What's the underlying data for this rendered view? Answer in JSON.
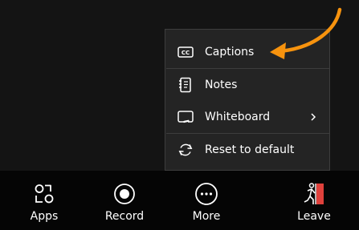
{
  "menu": {
    "items": [
      {
        "label": "Captions",
        "icon": "closed-captions-icon"
      },
      {
        "label": "Notes",
        "icon": "notes-icon"
      },
      {
        "label": "Whiteboard",
        "icon": "whiteboard-icon",
        "has_submenu": true
      },
      {
        "label": "Reset to default",
        "icon": "reset-icon"
      }
    ]
  },
  "toolbar": {
    "buttons": [
      {
        "label": "Apps",
        "icon": "apps-icon"
      },
      {
        "label": "Record",
        "icon": "record-icon"
      },
      {
        "label": "More",
        "icon": "more-icon"
      },
      {
        "label": "Leave",
        "icon": "leave-icon"
      }
    ]
  },
  "colors": {
    "background": "#141414",
    "menu_background": "#242424",
    "toolbar_background": "#050505",
    "annotation_arrow": "#f7930e",
    "leave_door": "#e0413c"
  }
}
